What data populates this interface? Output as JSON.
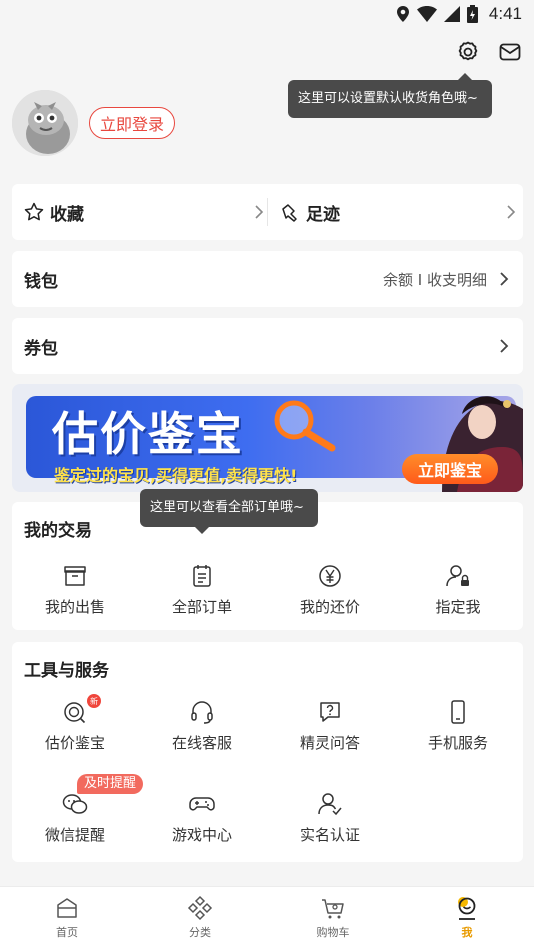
{
  "status_bar": {
    "time": "4:41"
  },
  "tooltips": {
    "role_tip": "这里可以设置默认收货角色哦~",
    "order_tip": "这里可以查看全部订单哦~"
  },
  "user": {
    "login_label": "立即登录"
  },
  "favorites": {
    "collect_label": "收藏",
    "footprint_label": "足迹"
  },
  "wallet": {
    "title": "钱包",
    "detail": "余额 I 收支明细"
  },
  "coupon": {
    "title": "券包"
  },
  "banner": {
    "title": "估价鉴宝",
    "subtitle": "鉴定过的宝贝,买得更值,卖得更快!",
    "cta": "立即鉴宝"
  },
  "trade": {
    "title": "我的交易",
    "items": [
      {
        "label": "我的出售",
        "icon": "store-icon"
      },
      {
        "label": "全部订单",
        "icon": "order-list-icon"
      },
      {
        "label": "我的还价",
        "icon": "yen-icon"
      },
      {
        "label": "指定我",
        "icon": "user-lock-icon"
      }
    ]
  },
  "tools": {
    "title": "工具与服务",
    "items": [
      {
        "label": "估价鉴宝",
        "icon": "appraise-icon",
        "badge": "新"
      },
      {
        "label": "在线客服",
        "icon": "headset-icon"
      },
      {
        "label": "精灵问答",
        "icon": "question-icon"
      },
      {
        "label": "手机服务",
        "icon": "phone-icon"
      },
      {
        "label": "微信提醒",
        "icon": "wechat-icon",
        "badge": "及时提醒"
      },
      {
        "label": "游戏中心",
        "icon": "gamepad-icon"
      },
      {
        "label": "实名认证",
        "icon": "verify-user-icon"
      }
    ]
  },
  "tabbar": {
    "tabs": [
      {
        "label": "首页",
        "icon": "home-icon"
      },
      {
        "label": "分类",
        "icon": "category-icon"
      },
      {
        "label": "购物车",
        "icon": "cart-icon"
      },
      {
        "label": "我",
        "icon": "profile-icon",
        "active": true
      }
    ]
  },
  "colors": {
    "accent_red": "#e8483f",
    "tab_active": "#e89a00",
    "banner_blue": "#2b57d8"
  }
}
